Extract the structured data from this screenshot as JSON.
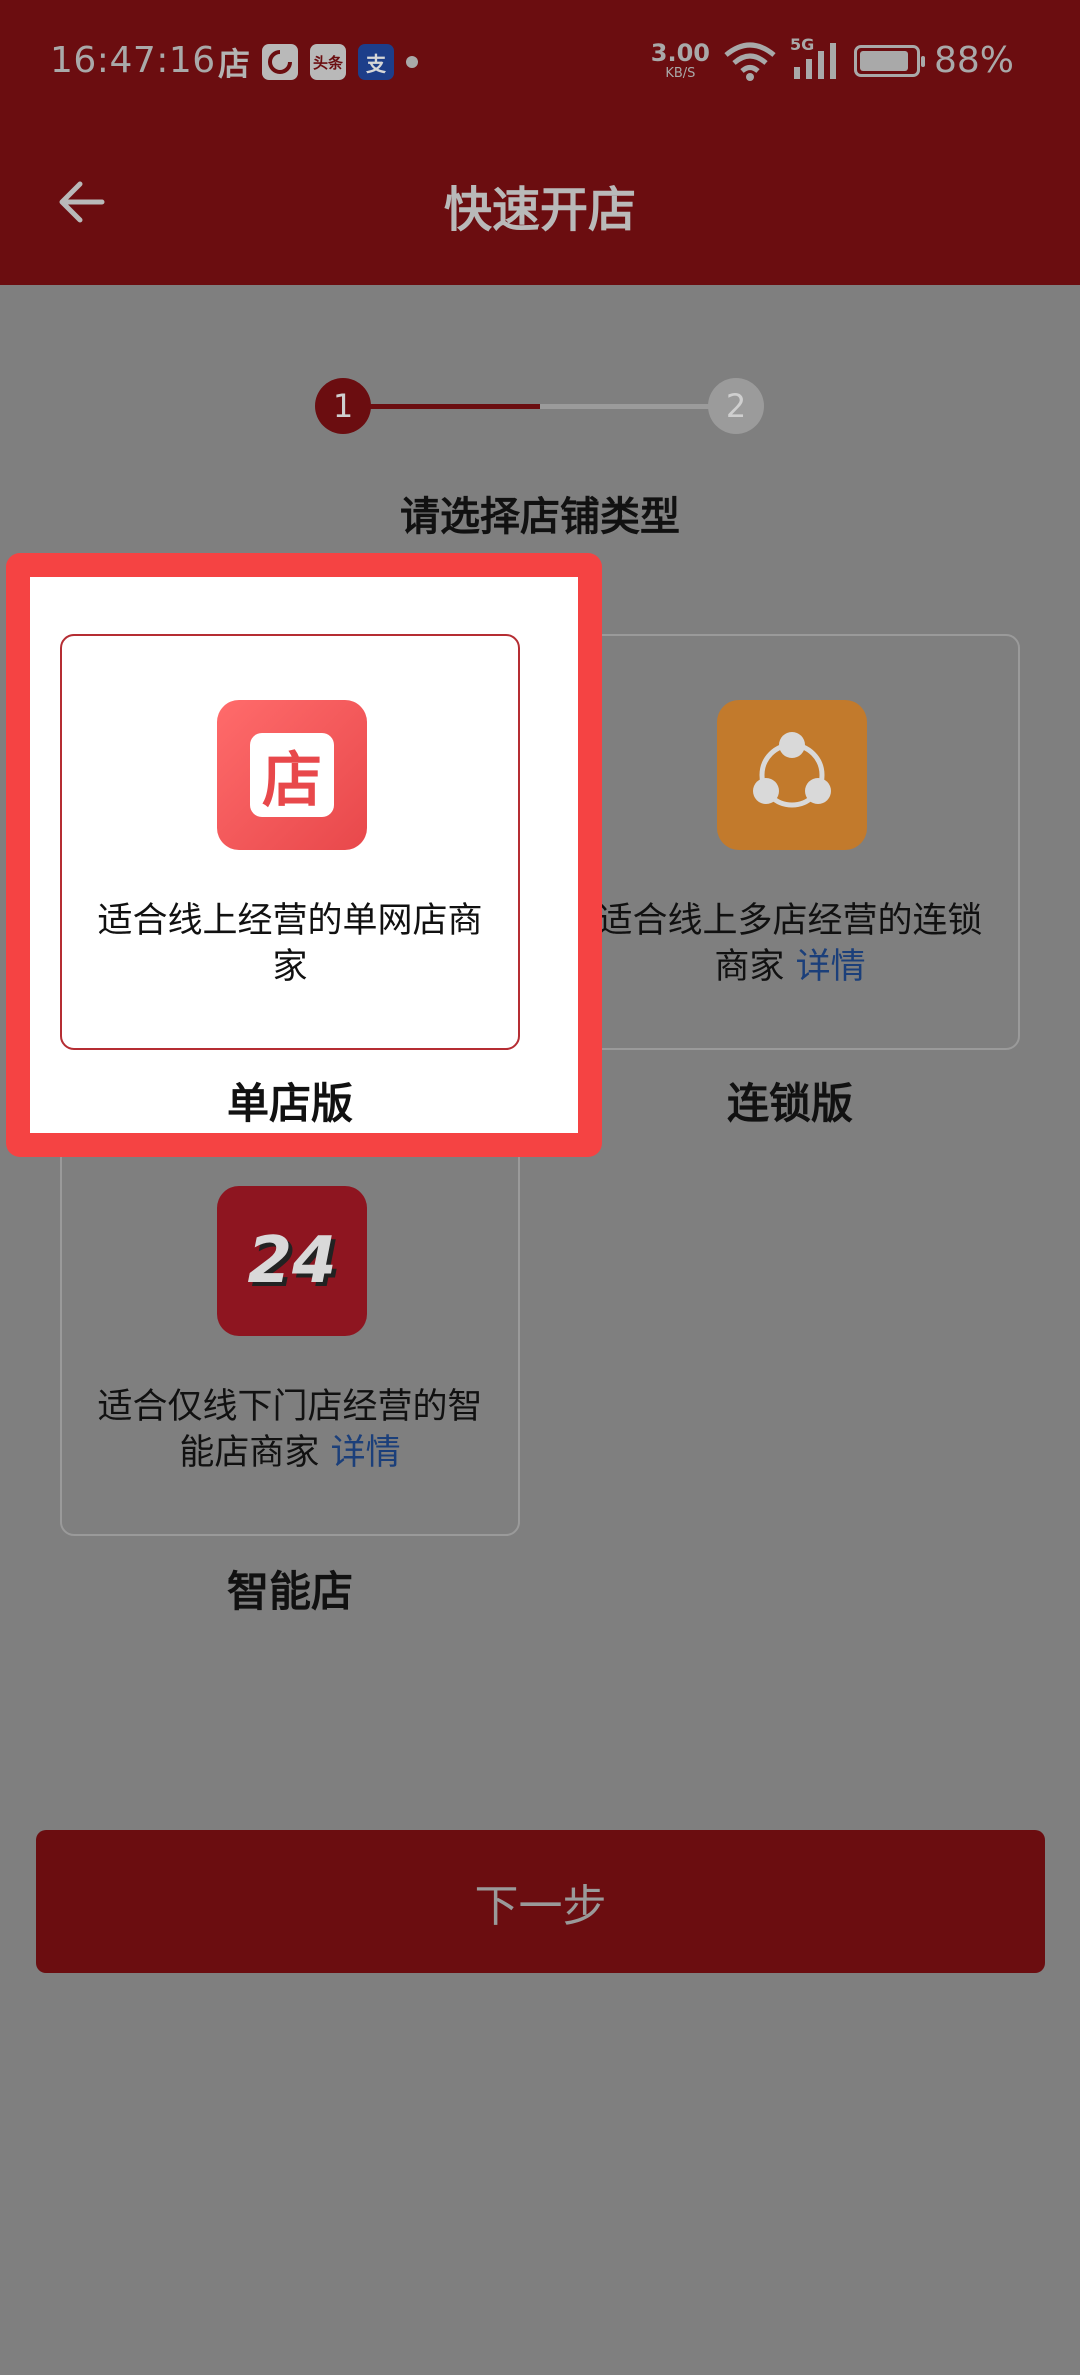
{
  "status_bar": {
    "time": "16:47:16",
    "app_icons": [
      "店",
      "",
      "头条",
      "支"
    ],
    "net_speed_value": "3.00",
    "net_speed_unit": "KB/S",
    "network": "5G",
    "battery_percent": "88%",
    "battery_level": 0.88
  },
  "header": {
    "title": "快速开店",
    "back_icon": "arrow-left-icon"
  },
  "stepper": {
    "steps": [
      "1",
      "2"
    ],
    "current_step": 1
  },
  "prompt": "请选择店铺类型",
  "store_types": [
    {
      "title": "单店版",
      "desc": "适合线上经营的单网店商家",
      "link": "",
      "icon": "store-icon",
      "selected": true
    },
    {
      "title": "连锁版",
      "desc": "适合线上多店经营的连锁商家",
      "link": "详情",
      "icon": "network-share-icon",
      "selected": false
    },
    {
      "title": "智能店",
      "desc": "适合仅线下门店经营的智能店商家",
      "link": "详情",
      "icon": "24-hour-icon",
      "selected": false
    }
  ],
  "icon_labels": {
    "store": "店",
    "smart": "24"
  },
  "next_button": "下一步",
  "colors": {
    "header": "#6b0d10",
    "highlight": "#f54343",
    "link": "#1b3f7a",
    "store_icon": "#f05a5a",
    "chain_icon": "#c27a2c"
  }
}
